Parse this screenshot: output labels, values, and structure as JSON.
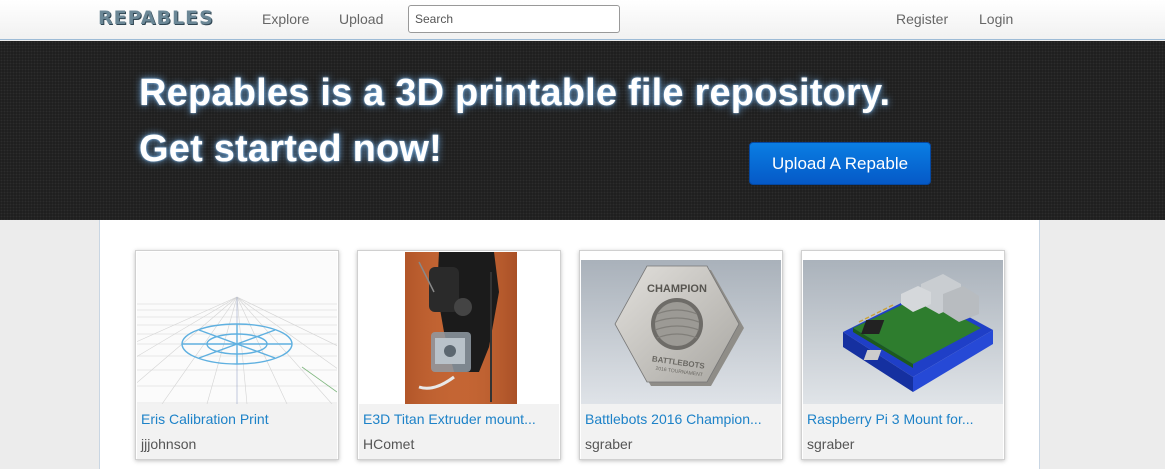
{
  "navbar": {
    "brand": "REPABLES",
    "links": {
      "explore": "Explore",
      "upload": "Upload",
      "register": "Register",
      "login": "Login"
    },
    "search": {
      "placeholder": "Search",
      "value": ""
    }
  },
  "hero": {
    "line1": "Repables is a 3D printable file repository.",
    "line2": "Get started now!",
    "cta_label": "Upload A Repable"
  },
  "colors": {
    "link": "#1d82c8",
    "cta": "#0a6fd8",
    "hero_bg": "#1c1c1c"
  },
  "cards": [
    {
      "title": "Eris Calibration Print",
      "author": "jjjohnson",
      "thumb": "calibration-grid"
    },
    {
      "title": "E3D Titan Extruder mount...",
      "author": "HComet",
      "thumb": "extruder-photo"
    },
    {
      "title": "Battlebots 2016 Champion...",
      "author": "sgraber",
      "thumb": "hex-nut-render",
      "thumb_text": "CHAMPION"
    },
    {
      "title": "Raspberry Pi 3 Mount for...",
      "author": "sgraber",
      "thumb": "raspberry-pi-render"
    }
  ]
}
